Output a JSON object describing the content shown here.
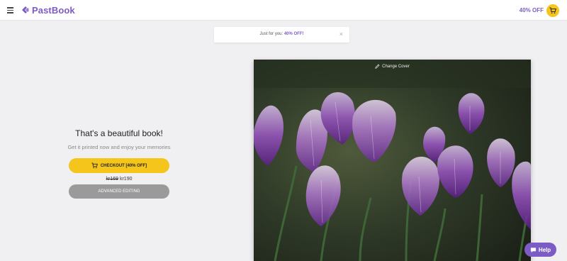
{
  "app": {
    "brand": "PastBook",
    "brand_color": "#7c5cc4",
    "accent_color": "#f5c51b"
  },
  "header": {
    "promo": "40% OFF",
    "cart_icon": "cart-icon",
    "menu_icon": "hamburger-icon"
  },
  "toast": {
    "prefix": "Just for you:",
    "highlight": "40% OFF!",
    "close": "×"
  },
  "main": {
    "headline": "That's a beautiful book!",
    "subline": "Get it printed now and enjoy your memories",
    "checkout_label": "CHECKOUT [40% OFF]",
    "price_old": "kr169",
    "price_new": "kr190",
    "advanced_label": "ADVANCED EDITING"
  },
  "cover": {
    "change_label": "Change Cover",
    "edit_icon": "pencil-icon"
  },
  "help": {
    "label": "Help",
    "icon": "chat-bubble-icon"
  }
}
